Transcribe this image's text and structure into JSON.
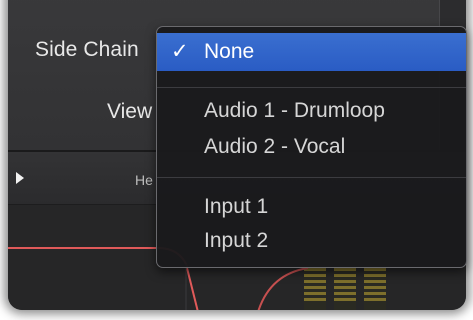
{
  "plugin": {
    "side_chain_label": "Side Chain",
    "view_label": "View",
    "header_label": "He"
  },
  "menu": {
    "selected_index": 0,
    "items": [
      {
        "label": "None",
        "checked": true
      },
      {
        "label": "Audio 1 - Drumloop",
        "checked": false
      },
      {
        "label": "Audio 2 - Vocal",
        "checked": false
      },
      {
        "label": "Input 1",
        "checked": false
      },
      {
        "label": "Input 2",
        "checked": false
      }
    ],
    "check_glyph": "✓"
  },
  "colors": {
    "selection": "#2f63c9",
    "menu_bg": "#1a1a1c",
    "curve": "#e05a5a",
    "meter": "#8a7a30"
  },
  "icons": {
    "play_arrow": "play-arrow-icon",
    "checkmark": "checkmark-icon"
  }
}
